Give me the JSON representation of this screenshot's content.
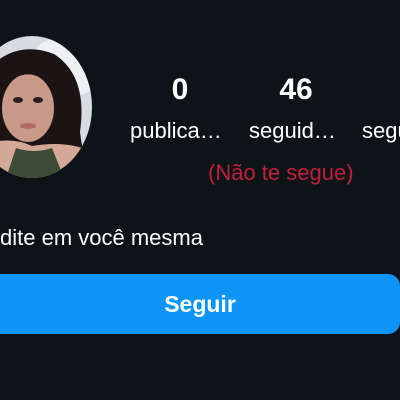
{
  "profile": {
    "stats": {
      "posts_count": "0",
      "posts_label": "publica…",
      "followers_count": "46",
      "followers_label": "seguid…",
      "following_label": "seguindo"
    },
    "follow_status": "(Não te segue)",
    "bio": "dite em você mesma",
    "follow_button_label": "Seguir"
  },
  "colors": {
    "background": "#0c1417",
    "accent_button": "#0c95f6",
    "status_red": "#c21f3a"
  }
}
